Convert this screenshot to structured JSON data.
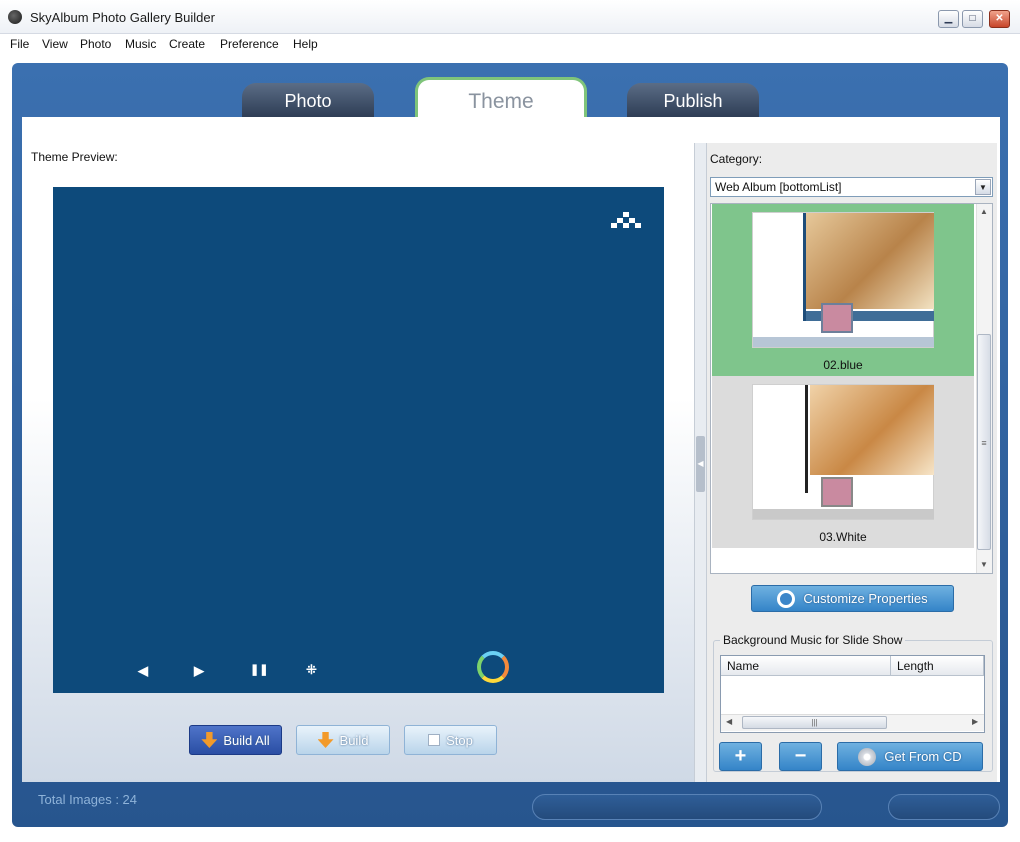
{
  "window": {
    "title": "SkyAlbum Photo Gallery Builder",
    "minimize": "▁",
    "maximize": "□",
    "close": "✕"
  },
  "menu": [
    "File",
    "View",
    "Photo",
    "Music",
    "Create",
    "Preference",
    "Help"
  ],
  "tabs": [
    {
      "label": "Photo",
      "active": false
    },
    {
      "label": "Theme",
      "active": true
    },
    {
      "label": "Publish",
      "active": false
    }
  ],
  "preview": {
    "label": "Theme Preview:",
    "controls": {
      "prev": "◀",
      "next": "▶",
      "pause": "❚❚",
      "grid": "⁜"
    },
    "background": "#0d4a7b"
  },
  "actions": {
    "build_all": "Build All",
    "build": "Build",
    "stop": "Stop"
  },
  "category": {
    "label": "Category:",
    "selected": "Web Album [bottomList]"
  },
  "themes": [
    {
      "name": "02.blue",
      "selected": true
    },
    {
      "name": "03.White",
      "selected": false
    }
  ],
  "customize": {
    "label": "Customize Properties"
  },
  "music": {
    "legend": "Background Music for Slide Show",
    "columns": [
      "Name",
      "Length"
    ],
    "add": "+",
    "remove": "−",
    "get_cd": "Get From CD"
  },
  "status": {
    "total_images": "Total Images : 24"
  },
  "colors": {
    "accent": "#3484c8",
    "frame": "#2c5c96",
    "selected_theme": "#7fc58c"
  }
}
